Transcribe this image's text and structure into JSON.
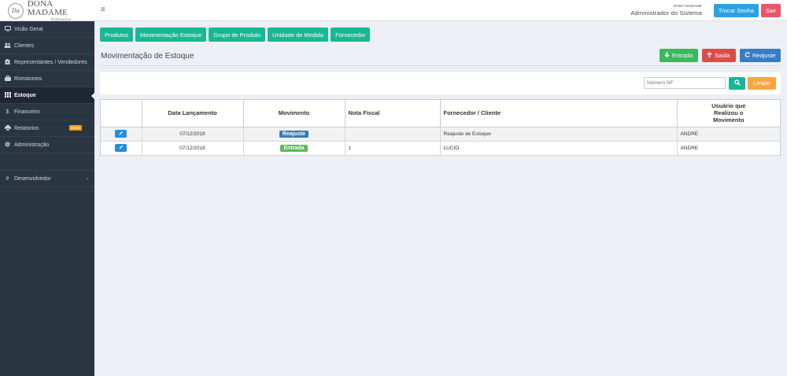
{
  "brand": {
    "mark": "Da",
    "title": "DONA MADAME",
    "subtitle": "Folheados"
  },
  "header": {
    "company": "DONA MADAME",
    "role": "Administrador do Sistema",
    "change_password_label": "Trocar Senha",
    "logout_label": "Sair",
    "menu_icon": "hamburger-icon"
  },
  "sidebar": {
    "items": [
      {
        "label": "Visão Geral",
        "icon": "monitor-icon"
      },
      {
        "label": "Clientes",
        "icon": "users-icon"
      },
      {
        "label": "Representantes / Vendedores",
        "icon": "id-card-icon"
      },
      {
        "label": "Romaneios",
        "icon": "briefcase-icon"
      },
      {
        "label": "Estoque",
        "icon": "grid-icon",
        "active": true
      },
      {
        "label": "Financeiro",
        "icon": "dollar-icon"
      },
      {
        "label": "Relatorios",
        "icon": "printer-icon",
        "badge": "Breve"
      },
      {
        "label": "Administração",
        "icon": "gear-icon"
      },
      {
        "label": "Desenvolvedor",
        "icon": "hash-icon"
      }
    ]
  },
  "tabs": [
    "Produtos",
    "Movimentação Estoque",
    "Grupo de Produto",
    "Unidade de Medida",
    "Fornecedor"
  ],
  "page": {
    "title": "Movimentação de Estoque"
  },
  "actions": {
    "entrada": "Entrada",
    "saida": "Saída",
    "reajuste": "Reajuste"
  },
  "filter": {
    "nf_placeholder": "Número NF",
    "clear_label": "Limpar"
  },
  "table": {
    "headers": [
      "",
      "Data Lançamento",
      "Movimento",
      "Nota Fiscal",
      "Fornecedor / Cliente",
      "Usuário que Realizou o Movimento"
    ],
    "rows": [
      {
        "date": "07/12/2018",
        "movement": "Reajuste",
        "nf": "",
        "party": "Reajuste de Estoque",
        "user": "ANDRE"
      },
      {
        "date": "07/12/2018",
        "movement": "Entrada",
        "nf": "1",
        "party": "LUCIO",
        "user": "ANDRE"
      }
    ]
  },
  "colors": {
    "sidebar_bg": "#2a3542",
    "accent_green": "#18b795",
    "blue": "#2ca0e1",
    "red": "#e9566a"
  }
}
